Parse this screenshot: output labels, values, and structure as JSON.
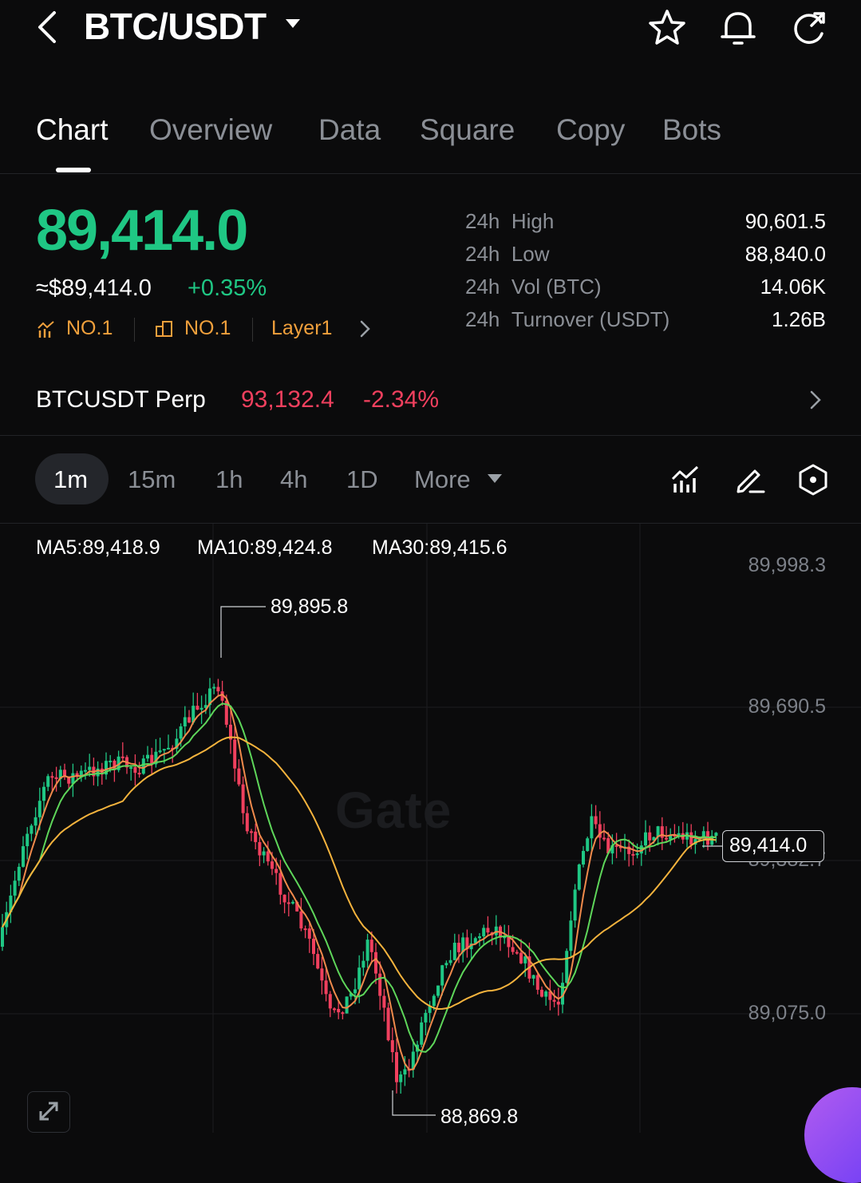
{
  "header": {
    "back_icon": "chevron-left-icon",
    "pair": "BTC/USDT",
    "icons": [
      "star-icon",
      "bell-icon",
      "refresh-icon"
    ]
  },
  "tabs": [
    {
      "label": "Chart",
      "active": true
    },
    {
      "label": "Overview"
    },
    {
      "label": "Data"
    },
    {
      "label": "Square"
    },
    {
      "label": "Copy"
    },
    {
      "label": "Bots"
    }
  ],
  "ticker": {
    "price": "89,414.0",
    "usd_price": "≈$89,414.0",
    "change": "+0.35%",
    "rank1": "NO.1",
    "rank2": "NO.1",
    "category": "Layer1",
    "price_color": "#1fc784"
  },
  "stats": [
    {
      "period": "24h",
      "label": "High",
      "value": "90,601.5"
    },
    {
      "period": "24h",
      "label": "Low",
      "value": "88,840.0"
    },
    {
      "period": "24h",
      "label": "Vol (BTC)",
      "value": "14.06K"
    },
    {
      "period": "24h",
      "label": "Turnover (USDT)",
      "value": "1.26B"
    }
  ],
  "perp": {
    "name": "BTCUSDT Perp",
    "price": "93,132.4",
    "change": "-2.34%",
    "color": "#f0405e"
  },
  "timeframes": [
    {
      "label": "1m",
      "active": true
    },
    {
      "label": "15m"
    },
    {
      "label": "1h"
    },
    {
      "label": "4h"
    },
    {
      "label": "1D"
    },
    {
      "label": "More"
    }
  ],
  "chart_tools": [
    "indicator-icon",
    "draw-pen-icon",
    "settings-hex-icon"
  ],
  "ma": {
    "ma5": "MA5:89,418.9",
    "ma10": "MA10:89,424.8",
    "ma30": "MA30:89,415.6",
    "ma5_color": "#f08a4b",
    "ma10_color": "#5ed65a",
    "ma30_color": "#f4b33d"
  },
  "chart": {
    "axis_labels": [
      "89,998.3",
      "89,690.5",
      "89,382.7",
      "89,075.0"
    ],
    "high_label": "89,895.8",
    "low_label": "88,869.8",
    "current_price": "89,414.0",
    "watermark": "Gate",
    "up_color": "#1fc784",
    "down_color": "#f0405e"
  }
}
